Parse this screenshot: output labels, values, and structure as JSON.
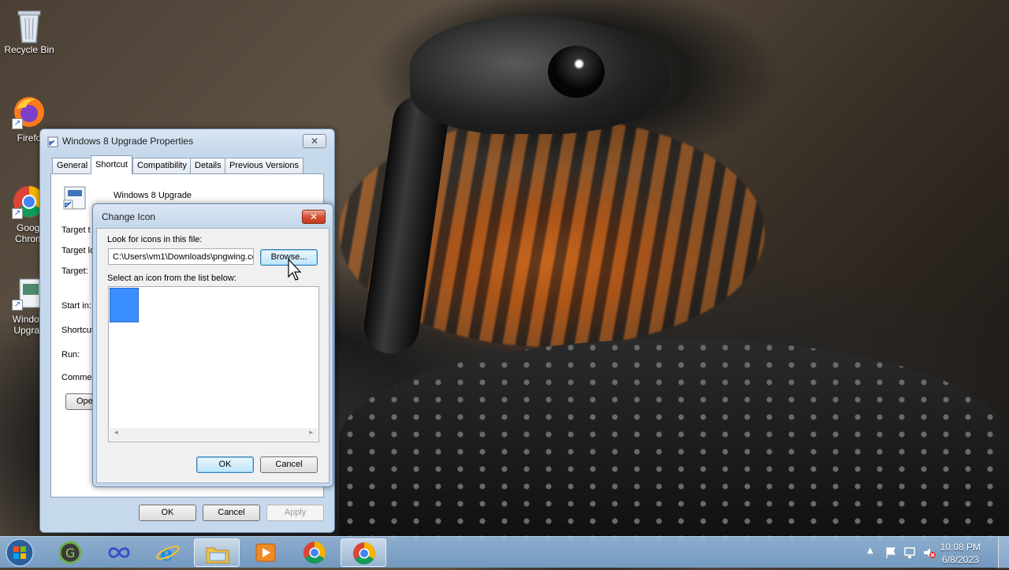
{
  "desktop": {
    "icons": [
      {
        "label": "Recycle Bin",
        "icon": "recycle-bin-icon"
      },
      {
        "label": "Firefo",
        "icon": "firefox-icon"
      },
      {
        "label_line1": "Googl",
        "label_line2": "Chrom",
        "icon": "chrome-icon"
      },
      {
        "label_line1": "Window",
        "label_line2": "Upgrad",
        "icon": "shortcut-file-icon"
      }
    ]
  },
  "properties": {
    "title": "Windows 8 Upgrade Properties",
    "tabs": [
      "General",
      "Shortcut",
      "Compatibility",
      "Details",
      "Previous Versions"
    ],
    "active_tab": "Shortcut",
    "shortcut_name": "Windows 8 Upgrade",
    "field_labels": [
      "Target t",
      "Target lo",
      "Target:",
      "Start in:",
      "Shortcut",
      "Run:",
      "Commer"
    ],
    "open_button": "Ope",
    "buttons": {
      "ok": "OK",
      "cancel": "Cancel",
      "apply": "Apply"
    }
  },
  "change_icon": {
    "title": "Change Icon",
    "look_label": "Look for icons in this file:",
    "file_path": "C:\\Users\\vm1\\Downloads\\pngwing.cc",
    "browse_button": "Browse...",
    "list_label": "Select an icon from the list below:",
    "ok_button": "OK",
    "cancel_button": "Cancel",
    "selected_icon_color": "#3a8eff"
  },
  "taskbar": {
    "items": [
      "start-orb",
      "greenshot-icon",
      "infinity-app-icon",
      "internet-explorer-icon",
      "file-explorer-icon",
      "media-player-icon",
      "chrome-icon",
      "chrome-icon"
    ],
    "active_index": 4,
    "clock_time": "10:08 PM",
    "clock_date": "6/8/2023"
  }
}
